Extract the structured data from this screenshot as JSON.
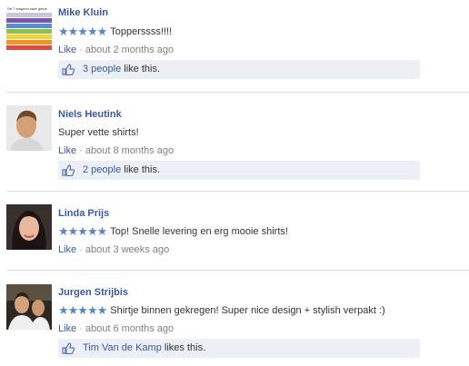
{
  "comments": [
    {
      "author": "Mike Kluin",
      "avatar": "rainbow-chart-thumbnail",
      "avatar_caption": "De 7 stappen naar geluk",
      "rating_stars": 5,
      "stars_glyph": "★★★★★",
      "text": "Topperssss!!!!",
      "like_label": "Like",
      "separator": "·",
      "time": "about 2 months ago",
      "likes": {
        "who": "3 people",
        "suffix": " like this."
      }
    },
    {
      "author": "Niels Heutink",
      "avatar": "man-portrait-photo",
      "text": "Super vette shirts!",
      "like_label": "Like",
      "separator": "·",
      "time": "about 8 months ago",
      "likes": {
        "who": "2 people",
        "suffix": " like this."
      }
    },
    {
      "author": "Linda Prijs",
      "avatar": "woman-portrait-photo",
      "rating_stars": 5,
      "stars_glyph": "★★★★★",
      "text": "Top! Snelle levering en erg mooie shirts!",
      "like_label": "Like",
      "separator": "·",
      "time": "about 3 weeks ago"
    },
    {
      "author": "Jurgen Strijbis",
      "avatar": "two-people-photo",
      "rating_stars": 5,
      "stars_glyph": "★★★★★",
      "text": "Shirtje binnen gekregen! Super nice design + stylish verpakt :)",
      "like_label": "Like",
      "separator": "·",
      "time": "about 6 months ago",
      "likes": {
        "who": "Tim Van de Kamp",
        "suffix": " likes this."
      }
    }
  ],
  "colors": {
    "link": "#3b5998",
    "stars": "#5b86c5",
    "meta": "#808080",
    "likebar_bg": "#eceff5",
    "divider": "#d8dfea"
  },
  "icons": {
    "like_thumb": "thumbs-up-icon",
    "rating": "star-icon"
  }
}
